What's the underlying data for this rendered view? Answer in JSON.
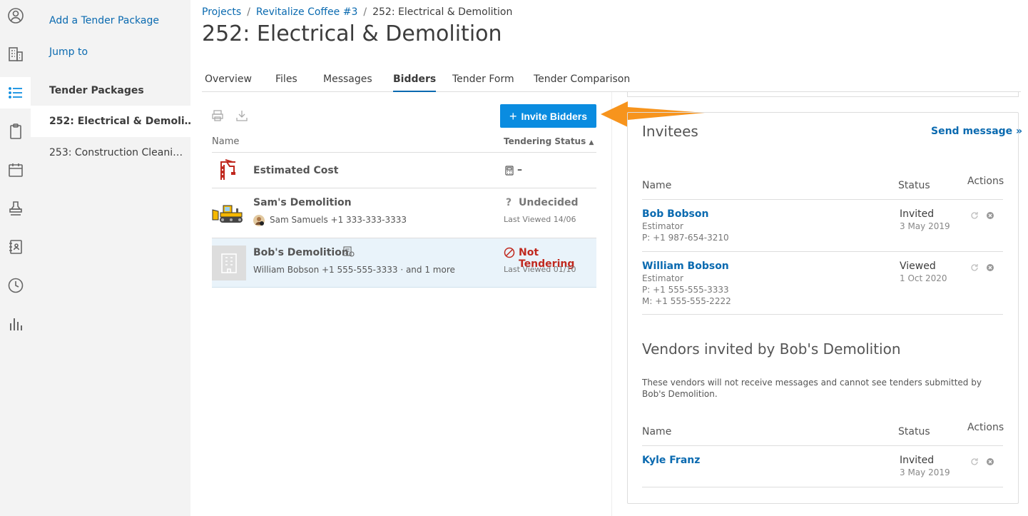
{
  "rail": {
    "icons": [
      "user-icon",
      "building-icon",
      "list-icon",
      "clipboard-icon",
      "calendar-icon",
      "stamp-icon",
      "contacts-book-icon",
      "clock-icon",
      "bar-chart-icon"
    ]
  },
  "sidebar": {
    "add_package": "Add a Tender Package",
    "jump_to": "Jump to",
    "heading": "Tender Packages",
    "items": [
      {
        "label": "252: Electrical & Demoli…"
      },
      {
        "label": "253: Construction Cleani…"
      }
    ]
  },
  "breadcrumb": {
    "projects": "Projects",
    "separator": "/",
    "project": "Revitalize Coffee #3",
    "current": "252: Electrical & Demolition"
  },
  "page": {
    "title": "252: Electrical & Demolition"
  },
  "tabs": [
    {
      "label": "Overview"
    },
    {
      "label": "Files"
    },
    {
      "label": "Messages"
    },
    {
      "label": "Bidders"
    },
    {
      "label": "Tender Form"
    },
    {
      "label": "Tender Comparison"
    }
  ],
  "bidders": {
    "invite_button": "Invite Bidders",
    "col_name": "Name",
    "col_status": "Tendering Status",
    "estimated_cost": {
      "label": "Estimated Cost",
      "value": "–"
    },
    "rows": [
      {
        "name": "Sam's Demolition",
        "contact": "Sam Samuels +1 333-333-3333",
        "status": "Undecided",
        "last_viewed": "Last Viewed 14/06"
      },
      {
        "name": "Bob's Demolition",
        "contact": "William Bobson +1 555-555-3333 · and 1 more",
        "status": "Not Tendering",
        "last_viewed": "Last Viewed 01/10"
      }
    ]
  },
  "invitees": {
    "title": "Invitees",
    "send_message": "Send message »",
    "col_name": "Name",
    "col_status": "Status",
    "col_actions": "Actions",
    "people": [
      {
        "name": "Bob Bobson",
        "role": "Estimator",
        "phone": "P: +1 987-654-3210",
        "status": "Invited",
        "date": "3 May 2019"
      },
      {
        "name": "William Bobson",
        "role": "Estimator",
        "phone": "P: +1 555-555-3333",
        "mobile": "M: +1 555-555-2222",
        "status": "Viewed",
        "date": "1 Oct 2020"
      }
    ]
  },
  "vendors": {
    "title": "Vendors invited by Bob's Demolition",
    "description": "These vendors will not receive messages and cannot see tenders submitted by Bob's Demolition.",
    "col_name": "Name",
    "col_status": "Status",
    "col_actions": "Actions",
    "people": [
      {
        "name": "Kyle Franz",
        "status": "Invited",
        "date": "3 May 2019"
      }
    ]
  },
  "colors": {
    "accent": "#0a8ce0",
    "link": "#0a6ab0",
    "not_tendering": "#c0281e",
    "arrow": "#f7941d"
  }
}
